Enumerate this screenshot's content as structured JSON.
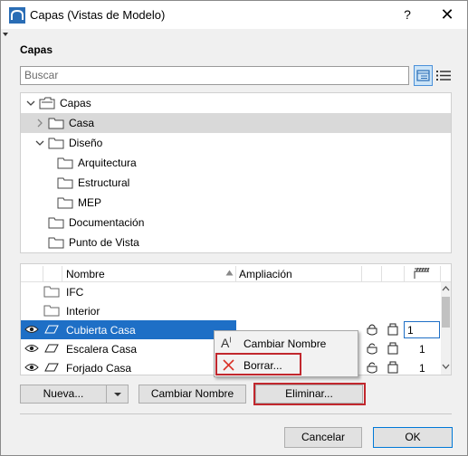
{
  "window": {
    "title": "Capas (Vistas de Modelo)",
    "help_label": "?",
    "close_label": "✕"
  },
  "section": {
    "label": "Capas"
  },
  "search": {
    "placeholder": "Buscar"
  },
  "tree": {
    "items": [
      {
        "label": "Capas",
        "level": 0,
        "expanded": true,
        "icon": "stacked-folder-icon"
      },
      {
        "label": "Casa",
        "level": 1,
        "expanded": false,
        "selected": true,
        "icon": "folder-icon"
      },
      {
        "label": "Diseño",
        "level": 1,
        "expanded": true,
        "icon": "folder-icon"
      },
      {
        "label": "Arquitectura",
        "level": 2,
        "icon": "folder-icon"
      },
      {
        "label": "Estructural",
        "level": 2,
        "icon": "folder-icon"
      },
      {
        "label": "MEP",
        "level": 2,
        "icon": "folder-icon"
      },
      {
        "label": "Documentación",
        "level": 1,
        "icon": "folder-icon"
      },
      {
        "label": "Punto de Vista",
        "level": 1,
        "icon": "folder-icon"
      }
    ]
  },
  "table": {
    "headers": {
      "name": "Nombre",
      "extension": "Ampliación"
    },
    "rows": [
      {
        "name": "IFC",
        "type": "folder",
        "value": ""
      },
      {
        "name": "Interior",
        "type": "folder",
        "value": ""
      },
      {
        "name": "Cubierta Casa",
        "type": "layer",
        "value": "1",
        "selected": true
      },
      {
        "name": "Escalera Casa",
        "type": "layer",
        "value": "1"
      },
      {
        "name": "Forjado Casa",
        "type": "layer",
        "value": "1"
      }
    ]
  },
  "context_menu": {
    "items": [
      {
        "label": "Cambiar Nombre",
        "icon": "rename-icon"
      },
      {
        "label": "Borrar...",
        "icon": "delete-x-icon"
      }
    ]
  },
  "buttons": {
    "new": "Nueva...",
    "rename": "Cambiar Nombre",
    "delete": "Eliminar...",
    "cancel": "Cancelar",
    "ok": "OK"
  },
  "colors": {
    "selection": "#1e6fc6",
    "highlight": "#c1272d",
    "tree_selection": "#d9d9d9"
  }
}
